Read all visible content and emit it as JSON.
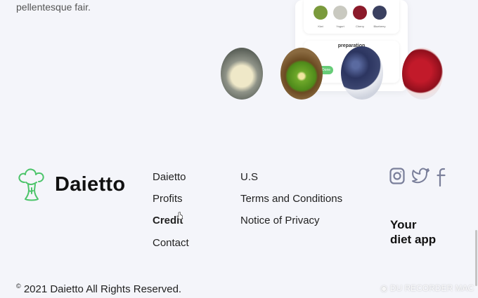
{
  "hero": {
    "text_snippet": "pellentesque fair.",
    "card": {
      "ingredients": [
        {
          "label": "Kiwi",
          "color": "#7a9a3c"
        },
        {
          "label": "Yogurt",
          "color": "#c9c9c0"
        },
        {
          "label": "Cherry",
          "color": "#8b1a2a"
        },
        {
          "label": "Blueberry",
          "color": "#3a4060"
        }
      ],
      "preparation_title": "preparation",
      "pill_label": "Done"
    }
  },
  "footer": {
    "brand": "Daietto",
    "col1": [
      "Daietto",
      "Profits",
      "Credit",
      "Contact"
    ],
    "col2": [
      "U.S",
      "Terms and Conditions",
      "Notice of Privacy"
    ],
    "social_icons": [
      "instagram-icon",
      "twitter-icon",
      "facebook-icon"
    ],
    "tagline_line1": "Your",
    "tagline_line2": "diet app",
    "copyright": "2021 Daietto All Rights Reserved.",
    "copyright_symbol": "©"
  },
  "watermark": "DU RECORDER MAC",
  "colors": {
    "background": "#f4f5fa",
    "logo_green": "#4cc46a",
    "social_gray": "#7a7f9a"
  }
}
